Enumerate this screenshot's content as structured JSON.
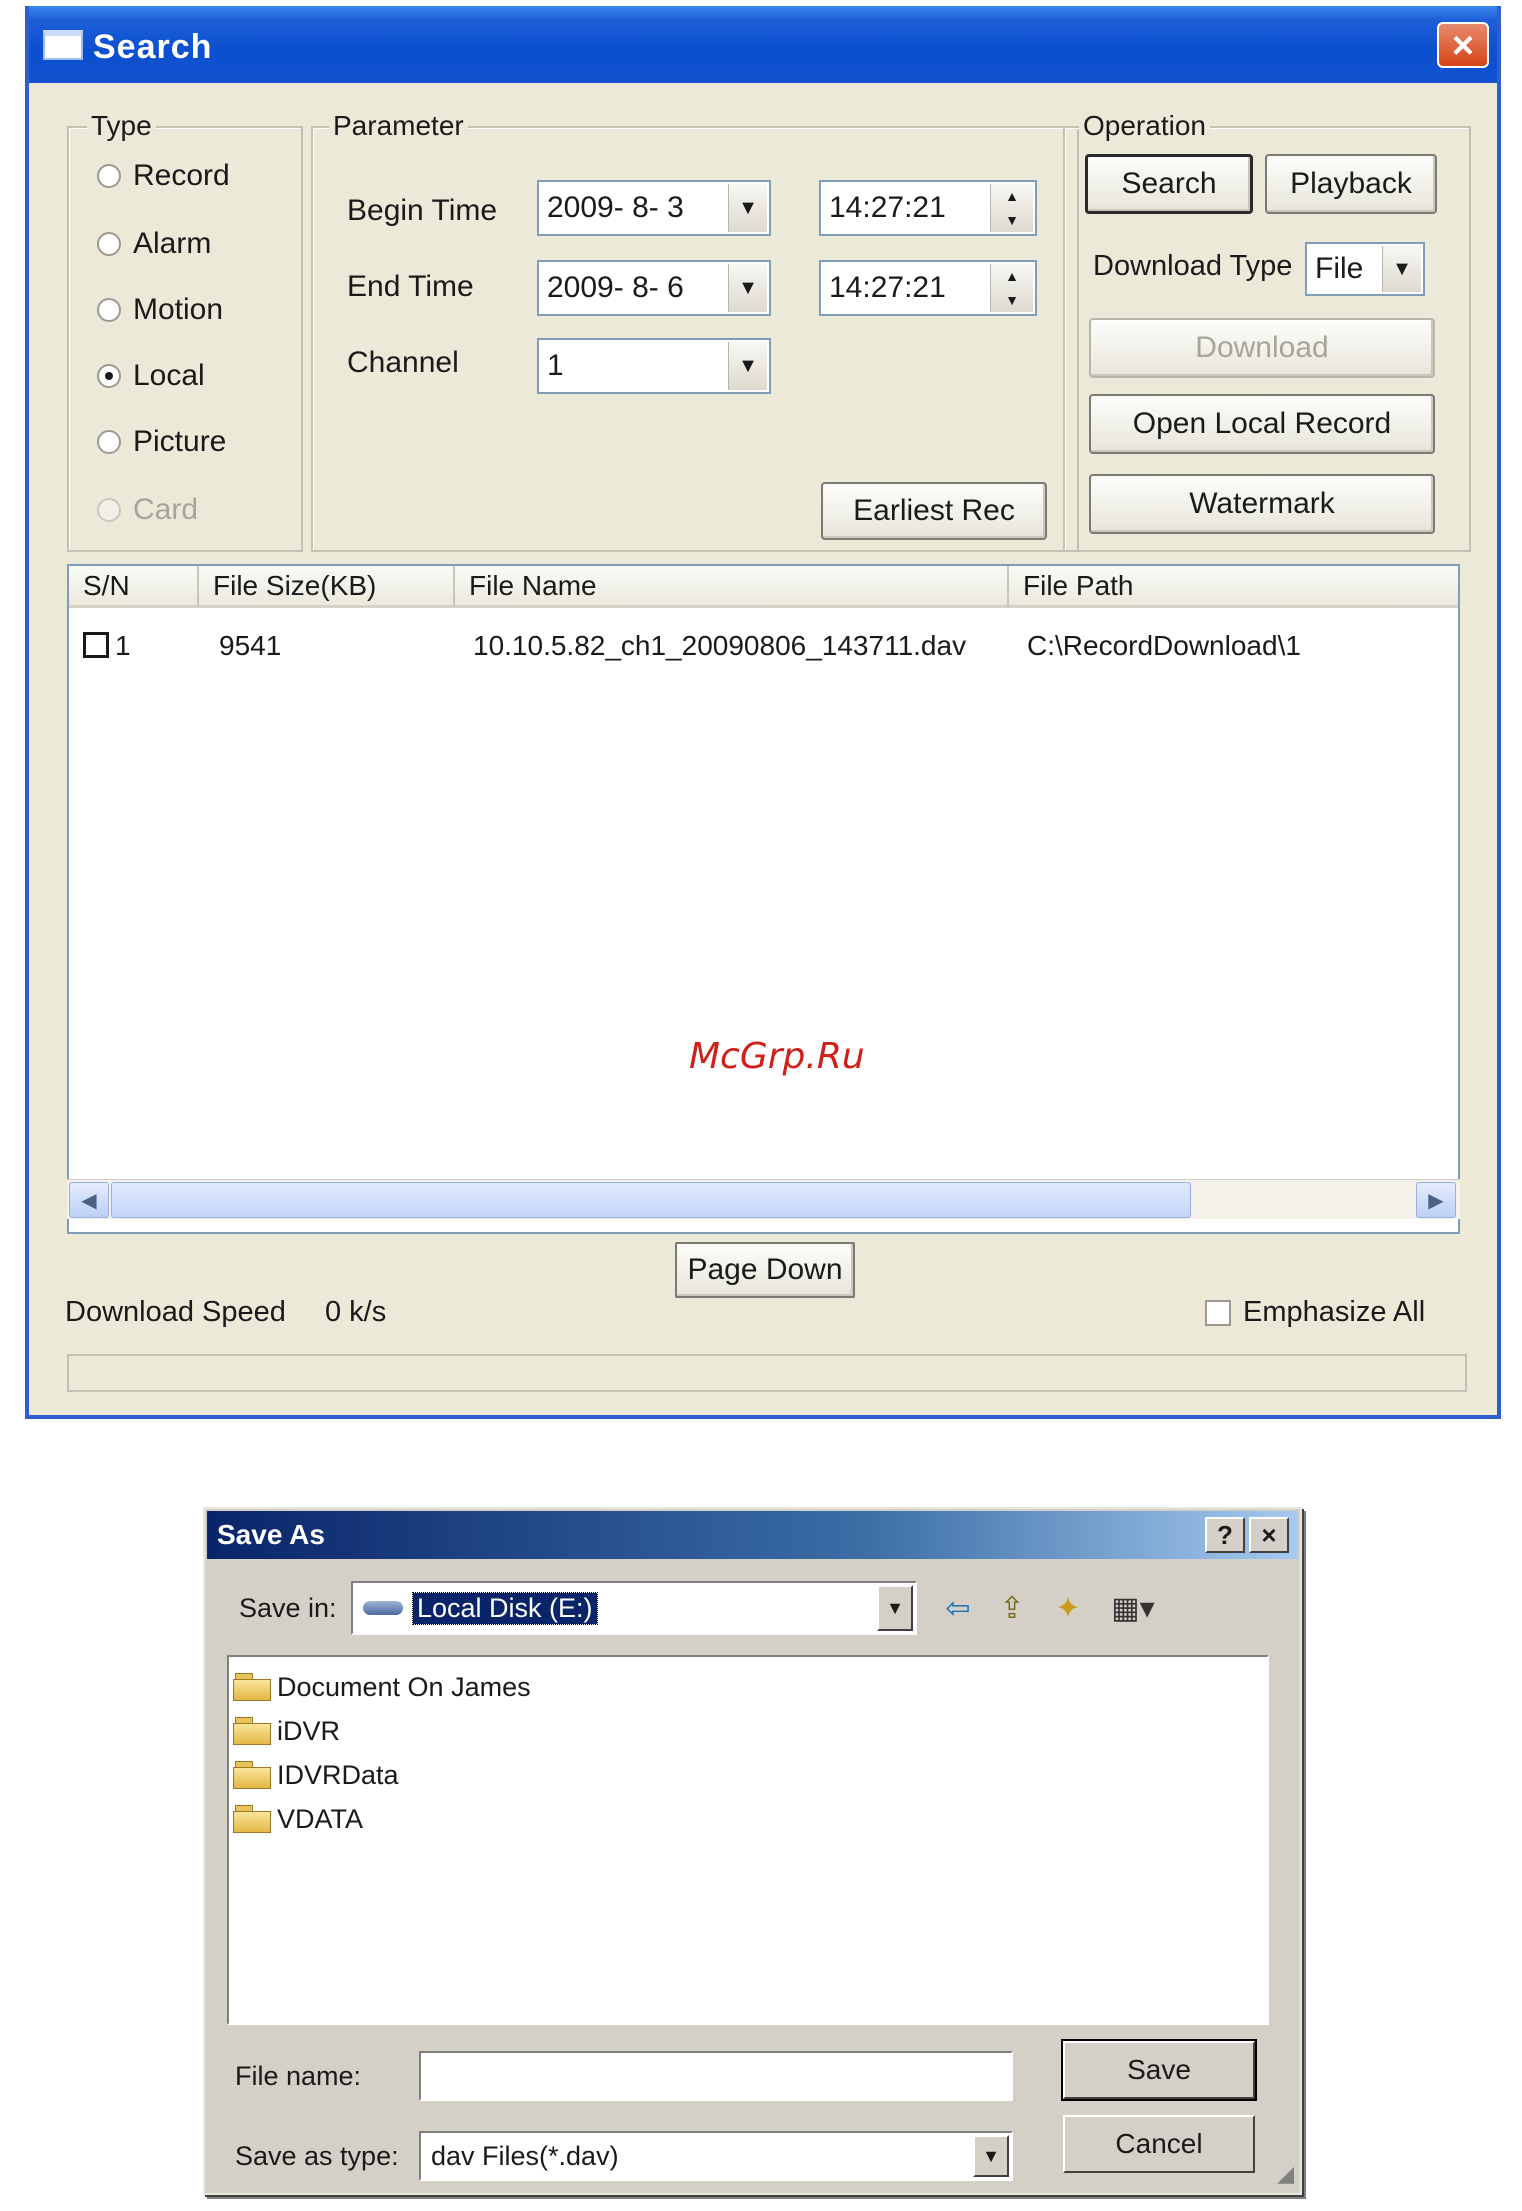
{
  "search_window": {
    "title": "Search",
    "type_group": {
      "label": "Type",
      "options": [
        {
          "label": "Record",
          "checked": false,
          "disabled": false
        },
        {
          "label": "Alarm",
          "checked": false,
          "disabled": false
        },
        {
          "label": "Motion",
          "checked": false,
          "disabled": false
        },
        {
          "label": "Local",
          "checked": true,
          "disabled": false
        },
        {
          "label": "Picture",
          "checked": false,
          "disabled": false
        },
        {
          "label": "Card",
          "checked": false,
          "disabled": true
        }
      ]
    },
    "parameter_group": {
      "label": "Parameter",
      "begin_time_label": "Begin Time",
      "begin_date": "2009- 8- 3",
      "begin_time": "14:27:21",
      "end_time_label": "End Time",
      "end_date": "2009- 8- 6",
      "end_time": "14:27:21",
      "channel_label": "Channel",
      "channel_value": "1",
      "earliest_rec_label": "Earliest Rec"
    },
    "operation_group": {
      "label": "Operation",
      "search_label": "Search",
      "playback_label": "Playback",
      "download_type_label": "Download Type",
      "download_type_value": "File",
      "download_label": "Download",
      "open_local_record_label": "Open Local Record",
      "watermark_label": "Watermark"
    },
    "file_table": {
      "columns": [
        "S/N",
        "File Size(KB)",
        "File Name",
        "File Path"
      ],
      "rows": [
        {
          "sn": "1",
          "size": "9541",
          "name": "10.10.5.82_ch1_20090806_143711.dav",
          "path": "C:\\RecordDownload\\1"
        }
      ]
    },
    "page_down_label": "Page Down",
    "download_speed_label": "Download Speed",
    "download_speed_value": "0 k/s",
    "emphasize_all_label": "Emphasize All",
    "watermark_text": "McGrp.Ru"
  },
  "save_as": {
    "title": "Save As",
    "help_glyph": "?",
    "close_glyph": "×",
    "save_in_label": "Save in:",
    "save_in_value": "Local Disk (E:)",
    "folders": [
      "Document On James",
      "iDVR",
      "IDVRData",
      "VDATA"
    ],
    "file_name_label": "File name:",
    "file_name_value": "",
    "save_as_type_label": "Save as type:",
    "save_as_type_value": "dav Files(*.dav)",
    "save_label": "Save",
    "cancel_label": "Cancel"
  }
}
